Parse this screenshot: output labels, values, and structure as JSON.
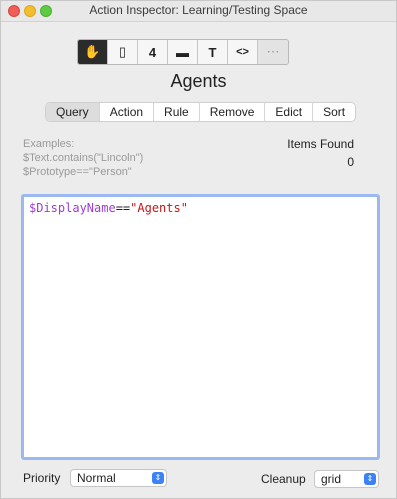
{
  "window": {
    "title": "Action Inspector: Learning/Testing Space"
  },
  "toolbar": {
    "buttons": [
      {
        "icon": "hand-icon",
        "glyph": "✋"
      },
      {
        "icon": "note-icon",
        "glyph": "▯"
      },
      {
        "icon": "four-icon",
        "glyph": "4"
      },
      {
        "icon": "window-icon",
        "glyph": "▬"
      },
      {
        "icon": "text-icon",
        "glyph": "T"
      },
      {
        "icon": "code-icon",
        "glyph": "<>"
      },
      {
        "icon": "more-icon",
        "glyph": "⋯"
      }
    ]
  },
  "header": {
    "title": "Agents"
  },
  "tabs": [
    {
      "label": "Query",
      "active": true
    },
    {
      "label": "Action",
      "active": false
    },
    {
      "label": "Rule",
      "active": false
    },
    {
      "label": "Remove",
      "active": false
    },
    {
      "label": "Edict",
      "active": false
    },
    {
      "label": "Sort",
      "active": false
    }
  ],
  "examples": {
    "heading": "Examples:",
    "lines": [
      "$Text.contains(\"Lincoln\")",
      "$Prototype==\"Person\""
    ]
  },
  "items_found": {
    "label": "Items Found",
    "count": "0"
  },
  "editor": {
    "attr": "$DisplayName",
    "op": "==",
    "str": "\"Agents\""
  },
  "bottom": {
    "priority_label": "Priority",
    "priority_value": "Normal",
    "cleanup_label": "Cleanup",
    "cleanup_value": "grid"
  },
  "colors": {
    "accent": "#3b82f6",
    "attr": "#9b3fd0",
    "string": "#c5161a",
    "focus_ring": "#9bb8f1"
  }
}
